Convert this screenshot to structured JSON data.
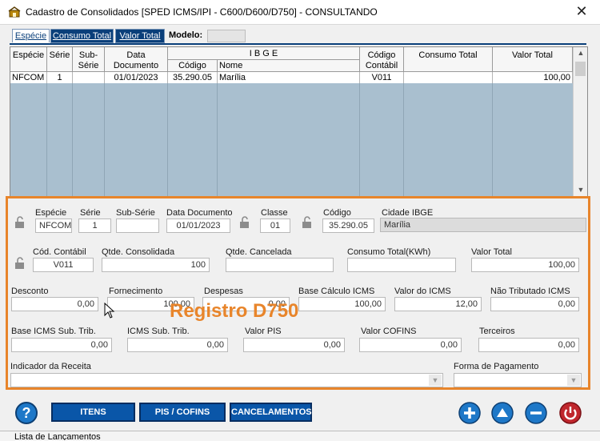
{
  "window": {
    "title": "Cadastro de Consolidados  [SPED ICMS/IPI - C600/D600/D750]   -   CONSULTANDO",
    "close": "✕"
  },
  "tabs": [
    {
      "label": "Espécie",
      "active": true
    },
    {
      "label": "Consumo Total",
      "active": false
    },
    {
      "label": "Valor Total",
      "active": false
    }
  ],
  "modelo": {
    "label": "Modelo:",
    "value": ""
  },
  "grid": {
    "group_header": "I B G E",
    "headers": {
      "especie": "Espécie",
      "serie": "Série",
      "subserie_1": "Sub-",
      "subserie_2": "Série",
      "data_1": "Data",
      "data_2": "Documento",
      "codigo": "Código",
      "nome": "Nome",
      "codcont_1": "Código",
      "codcont_2": "Contábil",
      "consumo": "Consumo Total",
      "valor": "Valor Total"
    },
    "row": {
      "especie": "NFCOM",
      "serie": "1",
      "subserie": "",
      "data": "01/01/2023",
      "codigo": "35.290.05",
      "nome": "Marília",
      "codcont": "V011",
      "consumo": "",
      "valor": "100,00"
    }
  },
  "form": {
    "especie": {
      "label": "Espécie",
      "value": "NFCOM"
    },
    "serie": {
      "label": "Série",
      "value": "1"
    },
    "subserie": {
      "label": "Sub-Série",
      "value": ""
    },
    "data_documento": {
      "label": "Data Documento",
      "value": "01/01/2023"
    },
    "classe": {
      "label": "Classe",
      "value": "01"
    },
    "codigo": {
      "label": "Código",
      "value": "35.290.05"
    },
    "cidade_ibge": {
      "label": "Cidade IBGE",
      "value": "Marília"
    },
    "cod_contabil": {
      "label": "Cód. Contábil",
      "value": "V011"
    },
    "qtde_consolidada": {
      "label": "Qtde. Consolidada",
      "value": "100"
    },
    "qtde_cancelada": {
      "label": "Qtde. Cancelada",
      "value": ""
    },
    "consumo_total": {
      "label": "Consumo Total(KWh)",
      "value": ""
    },
    "valor_total": {
      "label": "Valor Total",
      "value": "100,00"
    },
    "desconto": {
      "label": "Desconto",
      "value": "0,00"
    },
    "fornecimento": {
      "label": "Fornecimento",
      "value": "100,00"
    },
    "despesas": {
      "label": "Despesas",
      "value": "0,00"
    },
    "base_calculo_icms": {
      "label": "Base Cálculo ICMS",
      "value": "100,00"
    },
    "valor_icms": {
      "label": "Valor do  ICMS",
      "value": "12,00"
    },
    "nao_tributado_icms": {
      "label": "Não Tributado ICMS",
      "value": "0,00"
    },
    "base_icms_sub_trib": {
      "label": "Base ICMS Sub. Trib.",
      "value": "0,00"
    },
    "icms_sub_trib": {
      "label": "ICMS Sub. Trib.",
      "value": "0,00"
    },
    "valor_pis": {
      "label": "Valor PIS",
      "value": "0,00"
    },
    "valor_cofins": {
      "label": "Valor COFINS",
      "value": "0,00"
    },
    "terceiros": {
      "label": "Terceiros",
      "value": "0,00"
    },
    "indicador_receita": {
      "label": "Indicador da Receita",
      "value": ""
    },
    "forma_pagamento": {
      "label": "Forma de Pagamento",
      "value": ""
    }
  },
  "overlay_text": "Registro D750",
  "toolbar": {
    "help": "?",
    "itens": "ITENS",
    "pis_cofins": "PIS / COFINS",
    "cancelamentos": "CANCELAMENTOS"
  },
  "status": {
    "text": "Lista de Lançamentos"
  },
  "colors": {
    "accent_orange": "#e8852b",
    "dark_blue": "#0a3f7a",
    "grid_bg": "#a9bfcf",
    "green_button": "#1b8a2e",
    "red_button": "#c0272d",
    "help_button": "#1e78c8"
  }
}
